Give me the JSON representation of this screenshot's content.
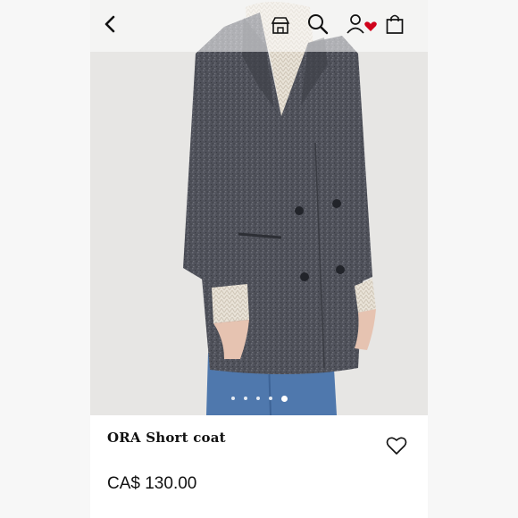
{
  "header": {
    "icons": {
      "back": "chevron-left-icon",
      "store": "store-icon",
      "search": "search-icon",
      "account": "account-heart-icon",
      "bag": "shopping-bag-icon"
    }
  },
  "gallery": {
    "image_subject": "coat photo",
    "image_count": 5,
    "active_index": 4
  },
  "product": {
    "title": "ORA Short coat",
    "price": "CA$ 130.00"
  },
  "colors": {
    "heart_accent": "#d0021b",
    "text": "#111111",
    "coat": "#4a4c55",
    "background": "#e6e5e3"
  }
}
